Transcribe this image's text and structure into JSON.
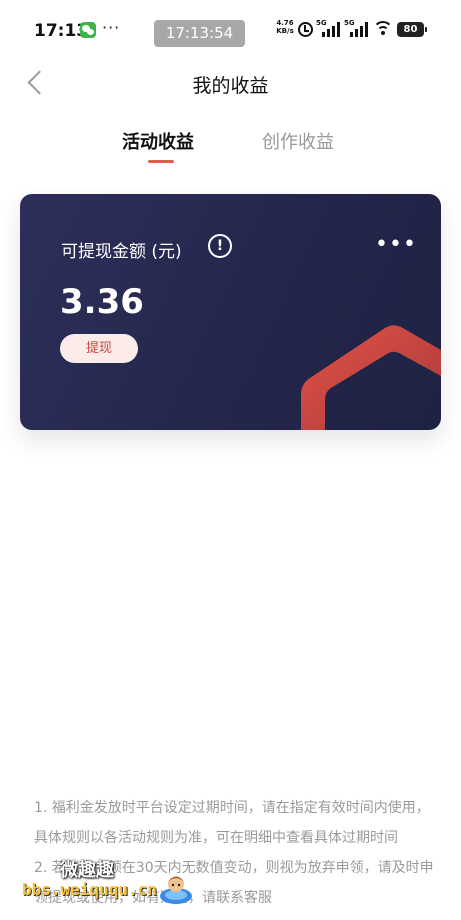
{
  "status_bar": {
    "time": "17:13",
    "overflow": "···",
    "clock_pill": "17:13:54",
    "net_speed_value": "4.76",
    "net_speed_unit": "KB/s",
    "signal1": "5G",
    "signal2": "5G",
    "battery": "80"
  },
  "header": {
    "title": "我的收益"
  },
  "tabs": [
    {
      "label": "活动收益",
      "active": true
    },
    {
      "label": "创作收益",
      "active": false
    }
  ],
  "card": {
    "label": "可提现金额 (元)",
    "info_glyph": "!",
    "more_glyph": "•••",
    "amount": "3.36",
    "withdraw_label": "提现",
    "deco_color": "#d9483c"
  },
  "notes": [
    "1. 福利金发放时平台设定过期时间，请在指定有效时间内使用，具体规则以各活动规则为准，可在明细中查看具体过期时间",
    "2. 若账户金额在30天内无数值变动，则视为放弃申领，请及时申领提现或使用，如有疑问，请联系客服"
  ],
  "watermark": {
    "text": "微趣趣",
    "url": "bbs.weiququ.cn"
  },
  "colors": {
    "accent": "#e45a4e",
    "card_bg": "#2a2c55",
    "withdraw_bg": "#fbece9",
    "withdraw_text": "#c64b3e"
  }
}
